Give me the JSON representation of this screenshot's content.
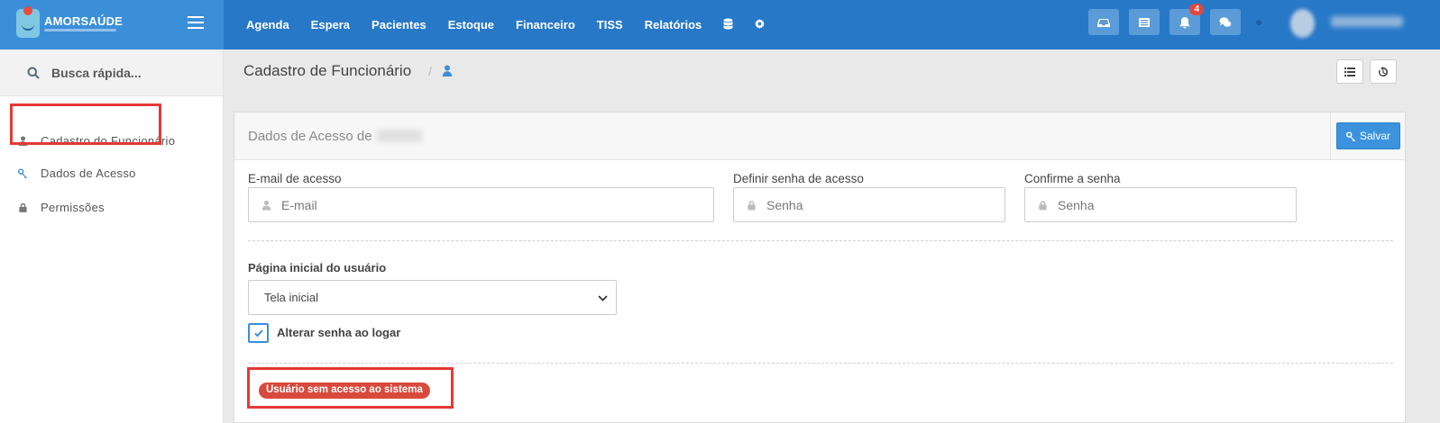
{
  "brand": {
    "name": "AMORSAÚDE"
  },
  "nav": {
    "items": [
      "Agenda",
      "Espera",
      "Pacientes",
      "Estoque",
      "Financeiro",
      "TISS",
      "Relatórios"
    ],
    "extra_icons": [
      "database-icon",
      "gear-icon"
    ]
  },
  "toolbar": {
    "notifications_count": "4"
  },
  "sidebar": {
    "search_label": "Busca rápida...",
    "items": [
      {
        "label": "Cadastro do Funcionário",
        "icon": "user-icon"
      },
      {
        "label": "Dados de Acesso",
        "icon": "key-icon",
        "active": true
      },
      {
        "label": "Permissões",
        "icon": "lock-icon"
      }
    ]
  },
  "page": {
    "title": "Cadastro de Funcionário"
  },
  "panel": {
    "title": "Dados de Acesso de",
    "save_label": "Salvar",
    "email_label": "E-mail de acesso",
    "email_placeholder": "E-mail",
    "password_label": "Definir senha de acesso",
    "password_placeholder": "Senha",
    "confirm_label": "Confirme a senha",
    "confirm_placeholder": "Senha",
    "home_label": "Página inicial do usuário",
    "home_value": "Tela inicial",
    "change_password_label": "Alterar senha ao logar",
    "change_password_checked": true,
    "status_text": "Usuário sem acesso ao sistema"
  },
  "colors": {
    "topbar": "#2878c8",
    "accent": "#3b8fd9",
    "danger": "#d94a3d",
    "highlight": "#e53935"
  }
}
